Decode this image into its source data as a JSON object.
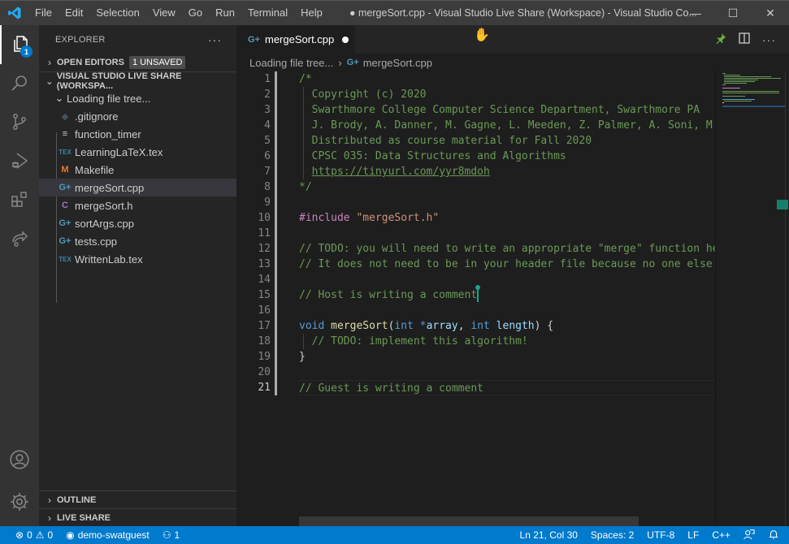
{
  "window": {
    "title": "● mergeSort.cpp - Visual Studio Live Share (Workspace) - Visual Studio Co...",
    "menu": [
      "File",
      "Edit",
      "Selection",
      "View",
      "Go",
      "Run",
      "Terminal",
      "Help"
    ],
    "controls": {
      "minimize": "—",
      "maximize": "☐",
      "close": "✕"
    }
  },
  "activity_bar": {
    "items": [
      {
        "name": "explorer",
        "icon": "files-icon",
        "badge": "1",
        "active": true
      },
      {
        "name": "search",
        "icon": "search-icon"
      },
      {
        "name": "source-control",
        "icon": "source-control-icon"
      },
      {
        "name": "run-debug",
        "icon": "run-debug-icon"
      },
      {
        "name": "extensions",
        "icon": "extensions-icon"
      },
      {
        "name": "live-share",
        "icon": "live-share-icon"
      }
    ],
    "bottom": [
      {
        "name": "accounts",
        "icon": "account-icon"
      },
      {
        "name": "manage",
        "icon": "gear-icon"
      }
    ]
  },
  "sidebar": {
    "title": "EXPLORER",
    "more": "···",
    "open_editors": {
      "label": "OPEN EDITORS",
      "badge": "1 UNSAVED"
    },
    "workspace": {
      "label": "VISUAL STUDIO LIVE SHARE (WORKSPA..."
    },
    "folder": {
      "label": "Loading file tree..."
    },
    "files": [
      {
        "name": ".gitignore",
        "icon": "git-icon",
        "glyph": "◆",
        "color": "#41535b"
      },
      {
        "name": "function_timer",
        "icon": "text-file-icon",
        "glyph": "≡",
        "color": "#cccccc"
      },
      {
        "name": "LearningLaTeX.tex",
        "icon": "tex-icon",
        "glyph": "TEX",
        "color": "#3e86a6"
      },
      {
        "name": "Makefile",
        "icon": "makefile-icon",
        "glyph": "M",
        "color": "#e37933"
      },
      {
        "name": "mergeSort.cpp",
        "icon": "cpp-icon",
        "glyph": "G+",
        "color": "#519aba",
        "selected": true
      },
      {
        "name": "mergeSort.h",
        "icon": "c-header-icon",
        "glyph": "C",
        "color": "#a074c4"
      },
      {
        "name": "sortArgs.cpp",
        "icon": "cpp-icon",
        "glyph": "G+",
        "color": "#519aba"
      },
      {
        "name": "tests.cpp",
        "icon": "cpp-icon",
        "glyph": "G+",
        "color": "#519aba"
      },
      {
        "name": "WrittenLab.tex",
        "icon": "tex-icon",
        "glyph": "TEX",
        "color": "#3e86a6"
      }
    ],
    "outline": "OUTLINE",
    "live_share": "LIVE SHARE"
  },
  "editor": {
    "tab": {
      "label": "mergeSort.cpp",
      "dirty": true
    },
    "breadcrumb": [
      "Loading file tree...",
      "mergeSort.cpp"
    ],
    "actions": {
      "pin": "pin-icon",
      "split": "split-editor-icon",
      "more": "···"
    },
    "current_line": 21,
    "lines": [
      [
        {
          "t": "/*",
          "c": "cm"
        }
      ],
      [
        {
          "t": "  Copyright (c) 2020",
          "c": "cm"
        }
      ],
      [
        {
          "t": "  Swarthmore College Computer Science Department, Swarthmore PA",
          "c": "cm"
        }
      ],
      [
        {
          "t": "  J. Brody, A. Danner, M. Gagne, L. Meeden, Z. Palmer, A. Soni, M. Wehar",
          "c": "cm"
        }
      ],
      [
        {
          "t": "  Distributed as course material for Fall 2020",
          "c": "cm"
        }
      ],
      [
        {
          "t": "  CPSC 035: Data Structures and Algorithms",
          "c": "cm"
        }
      ],
      [
        {
          "t": "  ",
          "c": "cm"
        },
        {
          "t": "https://tinyurl.com/yyr8mdoh",
          "c": "link"
        }
      ],
      [
        {
          "t": "*/",
          "c": "cm"
        }
      ],
      [],
      [
        {
          "t": "#include ",
          "c": "pp"
        },
        {
          "t": "\"mergeSort.h\"",
          "c": "st"
        }
      ],
      [],
      [
        {
          "t": "// TODO: you will need to write an appropriate \"merge\" function here",
          "c": "cm"
        }
      ],
      [
        {
          "t": "// It does not need to be in your header file because no one else will use it",
          "c": "cm"
        }
      ],
      [],
      [
        {
          "t": "// Host is writing a comment",
          "c": "cm"
        },
        {
          "t": "",
          "c": "host-cursor"
        }
      ],
      [],
      [
        {
          "t": "void ",
          "c": "kw"
        },
        {
          "t": "mergeSort",
          "c": "fn"
        },
        {
          "t": "(",
          "c": ""
        },
        {
          "t": "int ",
          "c": "kw"
        },
        {
          "t": "*",
          "c": "kw"
        },
        {
          "t": "array",
          "c": "vr"
        },
        {
          "t": ", ",
          "c": ""
        },
        {
          "t": "int ",
          "c": "kw"
        },
        {
          "t": "length",
          "c": "vr"
        },
        {
          "t": ") {",
          "c": ""
        }
      ],
      [
        {
          "t": "  // TODO: implement this algorithm!",
          "c": "cm"
        }
      ],
      [
        {
          "t": "}",
          "c": ""
        }
      ],
      [],
      [
        {
          "t": "// Guest is writing a comment",
          "c": "cm"
        }
      ]
    ]
  },
  "status_bar": {
    "errors": "0",
    "warnings": "0",
    "live_share_user": "demo-swatguest",
    "participants": "1",
    "position": "Ln 21, Col 30",
    "indent": "Spaces: 2",
    "encoding": "UTF-8",
    "eol": "LF",
    "language": "C++"
  }
}
